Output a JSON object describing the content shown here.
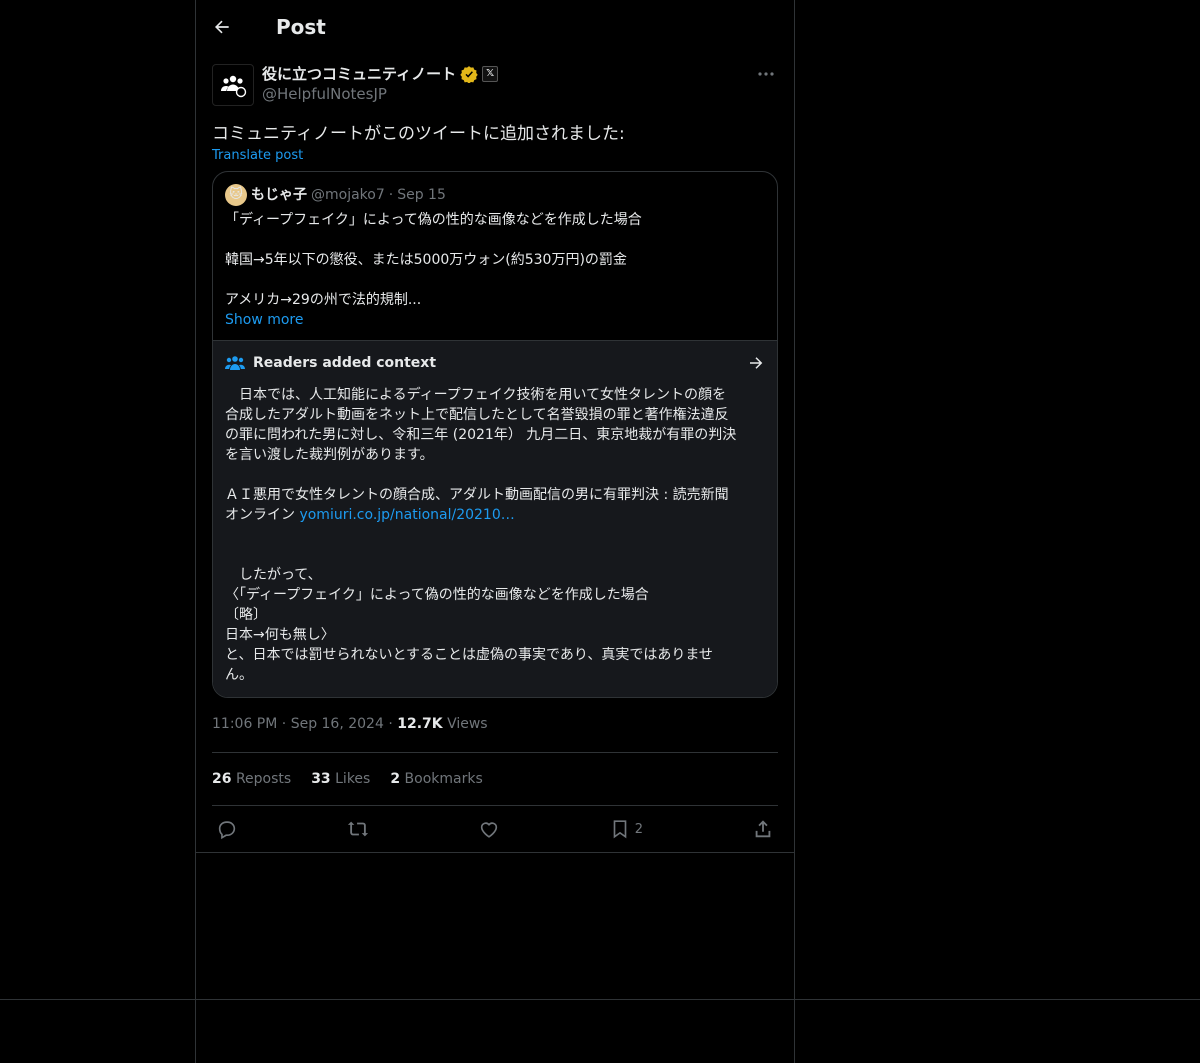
{
  "header": {
    "title": "Post"
  },
  "author": {
    "display_name": "役に立つコミュニティノート",
    "handle": "@HelpfulNotesJP",
    "affiliate_badge": "𝕏"
  },
  "post": {
    "text": "コミュニティノートがこのツイートに追加されました:",
    "translate_label": "Translate post"
  },
  "quote": {
    "name": "もじゃ子",
    "handle": "@mojako7",
    "dot": "·",
    "date": "Sep 15",
    "lines": [
      "「ディープフェイク」によって偽の性的な画像などを作成した場合",
      "",
      "韓国→5年以下の懲役、または5000万ウォン(約530万円)の罰金",
      "",
      "アメリカ→29の州で法的規制..."
    ],
    "show_more": "Show more"
  },
  "context": {
    "title": "Readers added context",
    "lines": [
      "　日本では、人工知能によるディープフェイク技術を用いて女性タレントの顔を",
      "合成したアダルト動画をネット上で配信したとして名誉毀損の罪と著作権法違反",
      "の罪に問われた男に対し、令和三年 (2021年） 九月二日、東京地裁が有罪の判決",
      "を言い渡した裁判例があります。",
      "",
      "ＡＩ悪用で女性タレントの顔合成、アダルト動画配信の男に有罪判決 : 読売新聞"
    ],
    "link_prefix": "オンライン ",
    "link_text": "yomiuri.co.jp/national/20210…",
    "lines2": [
      "",
      "",
      "　したがって、",
      "〈「ディープフェイク」によって偽の性的な画像などを作成した場合",
      "〔略〕",
      "日本→何も無し〉",
      "と、日本では罰せられないとすることは虚偽の事実であり、真実ではありませ",
      "ん。"
    ]
  },
  "meta": {
    "time": "11:06 PM",
    "dot": "·",
    "date": "Sep 16, 2024",
    "views_count": "12.7K",
    "views_label": "Views"
  },
  "stats": {
    "reposts_count": "26",
    "reposts_label": "Reposts",
    "likes_count": "33",
    "likes_label": "Likes",
    "bookmarks_count": "2",
    "bookmarks_label": "Bookmarks"
  },
  "actions": {
    "bookmark_count": "2"
  },
  "colors": {
    "background": "#000000",
    "accent": "#1d9bf0",
    "border": "#2f3336",
    "muted": "#71767b"
  }
}
